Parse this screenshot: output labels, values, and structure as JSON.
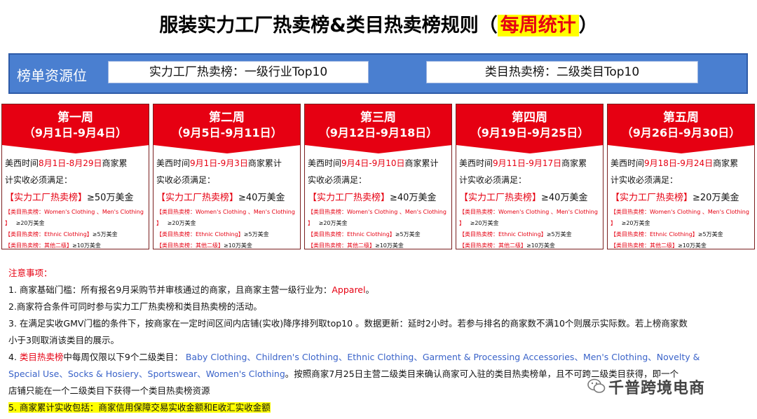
{
  "title": {
    "main": "服装实力工厂热卖榜&类目热卖榜规则（",
    "highlight": "每周统计",
    "close": "）"
  },
  "banner": {
    "label": "榜单资源位",
    "box1": "实力工厂热卖榜：一级行业Top10",
    "box2": "类目热卖榜：二级类目Top10"
  },
  "weeks": [
    {
      "title": "第一周",
      "dates": "（9月1日-9月4日）",
      "l1a": "美西时间",
      "l1b": "8月1日-8月29日",
      "l1c": "商家累",
      "l2": "计实收必须满足：",
      "f_tag": "【实力工厂热卖榜】",
      "f_amt": "≥50万美金",
      "c1_tag": "【类目热卖榜：Women's Clothing 、Men's Clothing 】",
      "c1_amt": "≥20万美金",
      "c2_tag": "【类目热卖榜：Ethnic Clothing】",
      "c2_amt": "≥5万美金",
      "c3_tag": "【类目热卖榜：其他二级】",
      "c3_amt": "≥10万美金"
    },
    {
      "title": "第二周",
      "dates": "（9月5日-9月11日）",
      "l1a": "美西时间",
      "l1b": "9月1日-9月3日",
      "l1c": "商家累计",
      "l2": "实收必须满足：",
      "f_tag": "【实力工厂热卖榜】",
      "f_amt": "≥40万美金",
      "c1_tag": "【类目热卖榜：Women's Clothing 、Men's Clothing 】",
      "c1_amt": "≥20万美金",
      "c2_tag": "【类目热卖榜：Ethnic Clothing】",
      "c2_amt": "≥5万美金",
      "c3_tag": "【类目热卖榜：其他二级】",
      "c3_amt": "≥10万美金"
    },
    {
      "title": "第三周",
      "dates": "（9月12日-9月18日）",
      "l1a": "美西时间",
      "l1b": "9月4日-9月10日",
      "l1c": "商家累计",
      "l2": "实收必须满足：",
      "f_tag": "【实力工厂热卖榜】",
      "f_amt": "≥40万美金",
      "c1_tag": "【类目热卖榜：Women's Clothing 、Men's Clothing 】",
      "c1_amt": "≥20万美金",
      "c2_tag": "【类目热卖榜：Ethnic Clothing】",
      "c2_amt": "≥5万美金",
      "c3_tag": "【类目热卖榜：其他二级】",
      "c3_amt": "≥10万美金"
    },
    {
      "title": "第四周",
      "dates": "（9月19日-9月25日）",
      "l1a": "美西时间",
      "l1b": "9月11日-9月17日",
      "l1c": "商家累",
      "l2": "计实收必须满足：",
      "f_tag": "【实力工厂热卖榜】",
      "f_amt": "≥40万美金",
      "c1_tag": "【类目热卖榜：Women's Clothing 、Men's Clothing 】",
      "c1_amt": "≥20万美金",
      "c2_tag": "【类目热卖榜：Ethnic Clothing】",
      "c2_amt": "≥5万美金",
      "c3_tag": "【类目热卖榜：其他二级】",
      "c3_amt": "≥10万美金"
    },
    {
      "title": "第五周",
      "dates": "（9月26日-9月30日）",
      "l1a": "美西时间",
      "l1b": "9月18日-9月24日",
      "l1c": "商家累",
      "l2": "计实收必须满足：",
      "f_tag": "【实力工厂热卖榜】",
      "f_amt": "≥20万美金",
      "c1_tag": "【类目热卖榜：Women's Clothing 、Men's Clothing 】",
      "c1_amt": "≥20万美金",
      "c2_tag": "【类目热卖榜：Ethnic Clothing】",
      "c2_amt": "≥5万美金",
      "c3_tag": "【类目热卖榜：其他二级】",
      "c3_amt": "≥10万美金"
    }
  ],
  "notes": {
    "heading": "注意事项：",
    "n1a": "1. 商家基础门槛：所有报名9月采购节并审核通过的商家，且商家主营一级行业为：",
    "n1b": "Apparel",
    "n1c": "。",
    "n2": "2.商家符合条件可同时参与实力工厂热卖榜和类目热卖榜的活动。",
    "n3a": "3. 在满足实收GMV门槛的条件下，按商家在一定时间区间内店铺(实收)降序排列取top10 。数据更新：延时2小时。若参与排名的商家数不满10个则展示实际数。若上榜商家数",
    "n3b": "小于3则取消该类目的展示。",
    "n4a": "4. ",
    "n4b": "类目热卖榜",
    "n4c": "中每周仅限以下9个二级类目：",
    "n4d": "Baby Clothing、Children's Clothing、Ethnic Clothing、Garment & Processing Accessories、Men's Clothing、Novelty &",
    "n4e": "Special Use、Socks & Hosiery、Sportswear、Women's Clothing",
    "n4f": "。按照商家7月25日主营二级类目来确认商家可入驻的类目热卖榜单，且不可跨二级类目获得，即一个",
    "n4g": "店铺只能在一个二级类目下获得一个类目热卖榜资源",
    "n5": "5. 商家累计实收包括：商家信用保障交易实收金额和E收汇实收金额"
  },
  "watermark": {
    "text": "千普跨境电商",
    "icon": "wechat-icon"
  }
}
